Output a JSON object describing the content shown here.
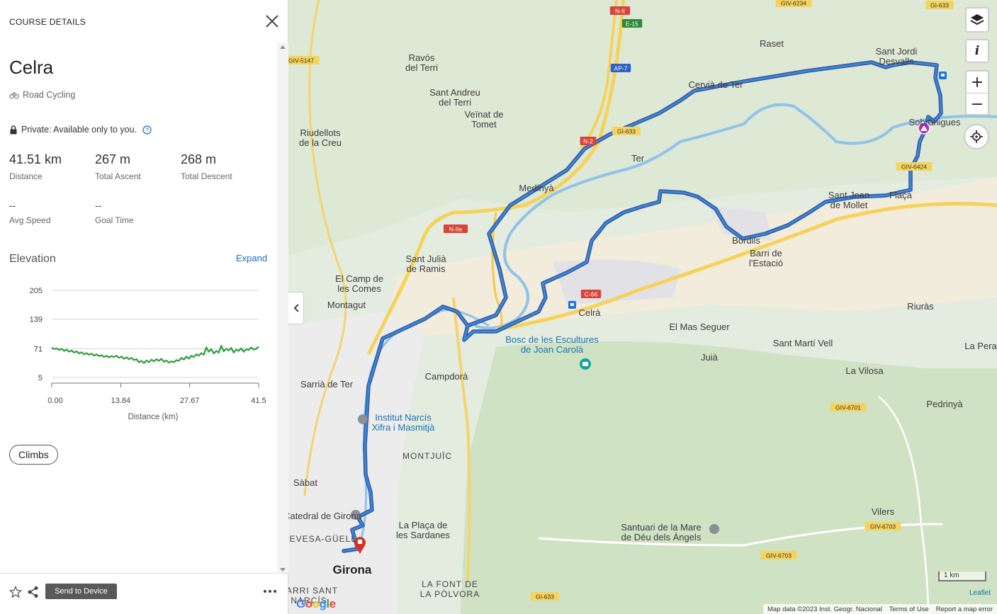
{
  "panel": {
    "header": "COURSE DETAILS",
    "title": "Celra",
    "sport": "Road Cycling",
    "privacy": "Private: Available only to you.",
    "stats": [
      {
        "value": "41.51 km",
        "label": "Distance"
      },
      {
        "value": "267 m",
        "label": "Total Ascent"
      },
      {
        "value": "268 m",
        "label": "Total Descent"
      },
      {
        "value": "--",
        "label": "Avg Speed"
      },
      {
        "value": "--",
        "label": "Goal Time"
      }
    ],
    "elevation_title": "Elevation",
    "expand_label": "Expand",
    "climbs_label": "Climbs",
    "send_label": "Send to Device"
  },
  "chart_data": {
    "type": "line",
    "title": "",
    "xlabel": "Distance (km)",
    "ylabel": "",
    "y_ticks": [
      "205",
      "139",
      "71",
      "5"
    ],
    "x_ticks": [
      "0.00",
      "13.84",
      "27.67",
      "41.5"
    ],
    "ylim": [
      5,
      205
    ],
    "xlim": [
      0,
      41.5
    ],
    "grid": true,
    "series": [
      {
        "color": "#2e9e3e",
        "x": [
          0,
          0.5,
          1,
          1.5,
          2,
          2.5,
          3,
          3.5,
          4,
          4.5,
          5,
          5.5,
          6,
          6.5,
          7,
          7.5,
          8,
          8.5,
          9,
          9.5,
          10,
          10.5,
          11,
          11.5,
          12,
          12.5,
          13,
          13.5,
          14,
          14.5,
          15,
          15.5,
          16,
          16.5,
          17,
          17.5,
          18,
          18.5,
          19,
          19.5,
          20,
          20.5,
          21,
          21.5,
          22,
          22.5,
          23,
          23.5,
          24,
          24.5,
          25,
          25.5,
          26,
          26.5,
          27,
          27.5,
          28,
          28.5,
          29,
          29.5,
          30,
          30.5,
          31,
          31.5,
          32,
          32.5,
          33,
          33.5,
          34,
          34.5,
          35,
          35.5,
          36,
          36.5,
          37,
          37.5,
          38,
          38.5,
          39,
          39.5,
          40,
          40.5,
          41,
          41.5
        ],
        "values": [
          74,
          70,
          72,
          68,
          71,
          66,
          69,
          64,
          67,
          62,
          65,
          60,
          63,
          58,
          61,
          57,
          60,
          55,
          58,
          54,
          56,
          52,
          55,
          51,
          54,
          52,
          55,
          50,
          53,
          48,
          51,
          47,
          50,
          45,
          47,
          40,
          43,
          38,
          44,
          40,
          46,
          42,
          47,
          43,
          48,
          41,
          44,
          39,
          42,
          40,
          45,
          43,
          50,
          46,
          53,
          48,
          55,
          52,
          58,
          55,
          61,
          57,
          74,
          64,
          70,
          60,
          66,
          62,
          78,
          65,
          71,
          67,
          73,
          62,
          69,
          66,
          72,
          64,
          70,
          68,
          74,
          69,
          71,
          76
        ]
      }
    ]
  },
  "map": {
    "labels": [
      "Ravós del Terri",
      "Sant Andreu del Terri",
      "Veïnat de Tomet",
      "Riudellots de la Creu",
      "Raset",
      "Sant Jordi Desvalls",
      "Cervià de Ter",
      "Sobrànigues",
      "Medinyà",
      "Sant Joan de Mollet",
      "Flaçà",
      "Sant Julià de Ramis",
      "El Camp de les Comes",
      "Montagut",
      "Bordils",
      "Barri de l'Estació",
      "Celrà",
      "Riuràs",
      "La Pera",
      "El Mas Seguer",
      "Sant Martí Vell",
      "Juià",
      "La Vilosa",
      "Bosc de les Escultures de Joan Carolà",
      "Campdorà",
      "Sarrià de Ter",
      "Institut Narcís Xifra i Masmitjà",
      "Pedrinyà",
      "MONTJUÏC",
      "Sàbat",
      "Catedral de Girona",
      "La Plaça de les Sardanes",
      "DEVESA-GÜELL",
      "Girona",
      "Santuari de la Mare de Déu dels Àngels",
      "Vilers",
      "LA FONT DE LA PÒLVORA",
      "BARRI SANT NARCÍS",
      "Ter"
    ],
    "road_labels": [
      "N-II",
      "E-15",
      "AP-7",
      "GIV-5147",
      "GIV-6234",
      "GI-633",
      "GI-633",
      "N-2",
      "N-IIa",
      "C-66",
      "GIV-6424",
      "GIV-6701",
      "GIV-6703",
      "GIV-6703",
      "GI-633"
    ],
    "attribution": "Map data ©2023 Inst. Geogr. Nacional",
    "terms": "Terms of Use",
    "report": "Report a map error",
    "scale": "1 km",
    "leaflet": "Leaflet",
    "google": "Google"
  }
}
